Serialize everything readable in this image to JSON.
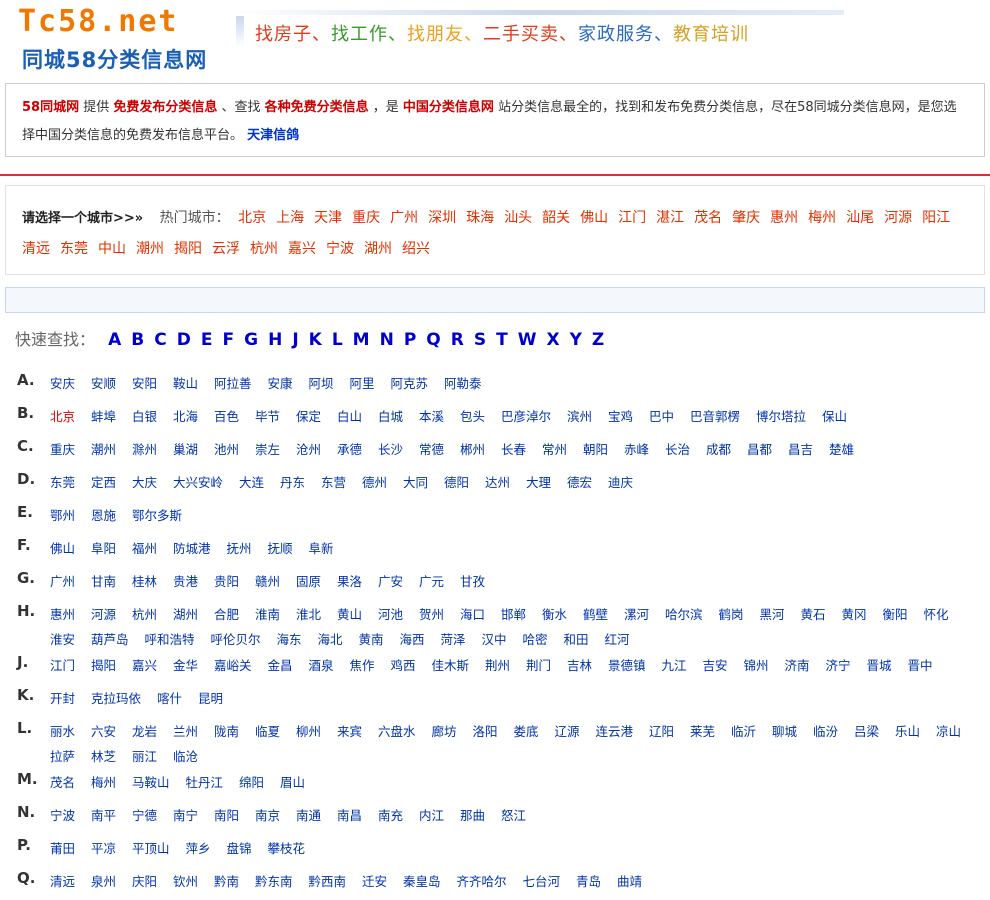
{
  "header": {
    "logo_line1": "Tc58.net",
    "logo_line2": "同城58分类信息网",
    "slogans": [
      {
        "text": "找房子",
        "color": "#e03c1c"
      },
      {
        "text": "、",
        "color": "#e03c1c"
      },
      {
        "text": "找工作",
        "color": "#3a9a2a"
      },
      {
        "text": "、",
        "color": "#3a9a2a"
      },
      {
        "text": "找朋友",
        "color": "#f0a020"
      },
      {
        "text": "、",
        "color": "#f0a020"
      },
      {
        "text": "二手买卖",
        "color": "#e03c1c"
      },
      {
        "text": "、",
        "color": "#e03c1c"
      },
      {
        "text": "家政服务",
        "color": "#2a6ac0"
      },
      {
        "text": "、",
        "color": "#2a6ac0"
      },
      {
        "text": "教育培训",
        "color": "#d8a020"
      }
    ]
  },
  "intro": {
    "segments": [
      {
        "text": "58同城网",
        "style": "kw"
      },
      {
        "text": " 提供 ",
        "style": "plain"
      },
      {
        "text": "免费发布分类信息",
        "style": "kw"
      },
      {
        "text": " 、查找 ",
        "style": "plain"
      },
      {
        "text": "各种免费分类信息",
        "style": "kw"
      },
      {
        "text": " ，是 ",
        "style": "plain"
      },
      {
        "text": "中国分类信息网",
        "style": "kw"
      },
      {
        "text": " 站分类信息最全的，找到和发布免费分类信息，尽在58同城分类信息网，是您选择中国分类信息的免费发布信息平台。 ",
        "style": "plain"
      },
      {
        "text": "天津信鸽",
        "style": "kw-blue"
      }
    ]
  },
  "city_select": {
    "prompt": "请选择一个城市>>»",
    "hot_label": "热门城市：",
    "hot_cities": [
      "北京",
      "上海",
      "天津",
      "重庆",
      "广州",
      "深圳",
      "珠海",
      "汕头",
      "韶关",
      "佛山",
      "江门",
      "湛江",
      "茂名",
      "肇庆",
      "惠州",
      "梅州",
      "汕尾",
      "河源",
      "阳江",
      "清远",
      "东莞",
      "中山",
      "潮州",
      "揭阳",
      "云浮",
      "杭州",
      "嘉兴",
      "宁波",
      "湖州",
      "绍兴"
    ]
  },
  "quick_find": {
    "label": "快速查找：",
    "letters": [
      "A",
      "B",
      "C",
      "D",
      "E",
      "F",
      "G",
      "H",
      "J",
      "K",
      "L",
      "M",
      "N",
      "P",
      "Q",
      "R",
      "S",
      "T",
      "W",
      "X",
      "Y",
      "Z"
    ]
  },
  "index": [
    {
      "letter": "A.",
      "cities": [
        "安庆",
        "安顺",
        "安阳",
        "鞍山",
        "阿拉善",
        "安康",
        "阿坝",
        "阿里",
        "阿克苏",
        "阿勒泰"
      ]
    },
    {
      "letter": "B.",
      "cities": [
        "北京",
        "蚌埠",
        "白银",
        "北海",
        "百色",
        "毕节",
        "保定",
        "白山",
        "白城",
        "本溪",
        "包头",
        "巴彦淖尔",
        "滨州",
        "宝鸡",
        "巴中",
        "巴音郭楞",
        "博尔塔拉",
        "保山"
      ],
      "highlight": [
        "北京"
      ]
    },
    {
      "letter": "C.",
      "cities": [
        "重庆",
        "潮州",
        "滁州",
        "巢湖",
        "池州",
        "崇左",
        "沧州",
        "承德",
        "长沙",
        "常德",
        "郴州",
        "长春",
        "常州",
        "朝阳",
        "赤峰",
        "长治",
        "成都",
        "昌都",
        "昌吉",
        "楚雄"
      ]
    },
    {
      "letter": "D.",
      "cities": [
        "东莞",
        "定西",
        "大庆",
        "大兴安岭",
        "大连",
        "丹东",
        "东营",
        "德州",
        "大同",
        "德阳",
        "达州",
        "大理",
        "德宏",
        "迪庆"
      ]
    },
    {
      "letter": "E.",
      "cities": [
        "鄂州",
        "恩施",
        "鄂尔多斯"
      ]
    },
    {
      "letter": "F.",
      "cities": [
        "佛山",
        "阜阳",
        "福州",
        "防城港",
        "抚州",
        "抚顺",
        "阜新"
      ]
    },
    {
      "letter": "G.",
      "cities": [
        "广州",
        "甘南",
        "桂林",
        "贵港",
        "贵阳",
        "赣州",
        "固原",
        "果洛",
        "广安",
        "广元",
        "甘孜"
      ]
    },
    {
      "letter": "H.",
      "cities": [
        "惠州",
        "河源",
        "杭州",
        "湖州",
        "合肥",
        "淮南",
        "淮北",
        "黄山",
        "河池",
        "贺州",
        "海口",
        "邯郸",
        "衡水",
        "鹤壁",
        "漯河",
        "哈尔滨",
        "鹤岗",
        "黑河",
        "黄石",
        "黄冈",
        "衡阳",
        "怀化",
        "淮安",
        "葫芦岛",
        "呼和浩特",
        "呼伦贝尔",
        "海东",
        "海北",
        "黄南",
        "海西",
        "菏泽",
        "汉中",
        "哈密",
        "和田",
        "红河"
      ]
    },
    {
      "letter": "J.",
      "cities": [
        "江门",
        "揭阳",
        "嘉兴",
        "金华",
        "嘉峪关",
        "金昌",
        "酒泉",
        "焦作",
        "鸡西",
        "佳木斯",
        "荆州",
        "荆门",
        "吉林",
        "景德镇",
        "九江",
        "吉安",
        "锦州",
        "济南",
        "济宁",
        "晋城",
        "晋中"
      ]
    },
    {
      "letter": "K.",
      "cities": [
        "开封",
        "克拉玛依",
        "喀什",
        "昆明"
      ]
    },
    {
      "letter": "L.",
      "cities": [
        "丽水",
        "六安",
        "龙岩",
        "兰州",
        "陇南",
        "临夏",
        "柳州",
        "来宾",
        "六盘水",
        "廊坊",
        "洛阳",
        "娄底",
        "辽源",
        "连云港",
        "辽阳",
        "莱芜",
        "临沂",
        "聊城",
        "临汾",
        "吕梁",
        "乐山",
        "凉山",
        "拉萨",
        "林芝",
        "丽江",
        "临沧"
      ]
    },
    {
      "letter": "M.",
      "cities": [
        "茂名",
        "梅州",
        "马鞍山",
        "牡丹江",
        "绵阳",
        "眉山"
      ]
    },
    {
      "letter": "N.",
      "cities": [
        "宁波",
        "南平",
        "宁德",
        "南宁",
        "南阳",
        "南京",
        "南通",
        "南昌",
        "南充",
        "内江",
        "那曲",
        "怒江"
      ]
    },
    {
      "letter": "P.",
      "cities": [
        "莆田",
        "平凉",
        "平顶山",
        "萍乡",
        "盘锦",
        "攀枝花"
      ]
    },
    {
      "letter": "Q.",
      "cities": [
        "清远",
        "泉州",
        "庆阳",
        "钦州",
        "黔南",
        "黔东南",
        "黔西南",
        "迁安",
        "秦皇岛",
        "齐齐哈尔",
        "七台河",
        "青岛",
        "曲靖"
      ]
    }
  ]
}
